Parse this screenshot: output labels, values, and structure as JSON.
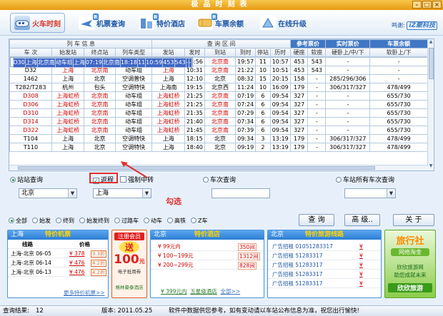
{
  "window": {
    "title": "极品时刻表",
    "min": "–",
    "max": "□",
    "close": "×"
  },
  "toolbar": {
    "items": [
      {
        "label": "火车时刻",
        "icon": "train-icon"
      },
      {
        "label": "机票查询",
        "icon": "plane-icon",
        "new": "新"
      },
      {
        "label": "特价酒店",
        "icon": "hotel-icon",
        "new": "新"
      },
      {
        "label": "车票余额",
        "icon": "ticket-icon",
        "new": "新"
      },
      {
        "label": "在线升级",
        "icon": "upgrade-icon"
      }
    ],
    "brand_prefix": "鸣谢:",
    "brand": "iZ聚科技"
  },
  "table": {
    "group_headers": [
      "列 车 信 息",
      "查 询 区 间",
      "参考票价",
      "实时票价",
      "车票余额"
    ],
    "columns": [
      "车 次",
      "始发站",
      "终点站",
      "列车类型",
      "发站",
      "发时",
      "到站",
      "到时",
      "停站",
      "历时",
      "硬座",
      "软座",
      "硬卧上/中/下",
      "软卧上/下"
    ],
    "rows": [
      [
        "D30",
        "上海",
        "北京南",
        "动车组",
        "上海",
        "07:19",
        "北京南",
        "18:18",
        "11",
        "10:59",
        "453",
        "543",
        "-",
        "-"
      ],
      [
        "D72",
        "上海",
        "北京南",
        "动车组",
        "上海",
        "08:56",
        "北京南",
        "19:57",
        "11",
        "10:57",
        "453",
        "543",
        "-",
        "-"
      ],
      [
        "D32",
        "上海",
        "北京南",
        "动车组",
        "上海",
        "10:31",
        "北京南",
        "21:22",
        "10",
        "10:51",
        "453",
        "543",
        "-",
        "-"
      ],
      [
        "1462",
        "上海",
        "北京",
        "空调普快",
        "上海",
        "12:10",
        "北京",
        "08:32",
        "15",
        "20:15",
        "158",
        "-",
        "285/296/306",
        "-"
      ],
      [
        "T282/T283",
        "杭州",
        "包头",
        "空调特快",
        "上海南",
        "19:15",
        "北京西",
        "11:24",
        "10",
        "16:09",
        "179",
        "-",
        "306/317/327",
        "478/499"
      ],
      [
        "D308",
        "上海虹桥",
        "北京南",
        "动车组",
        "上海虹桥",
        "21:25",
        "北京南",
        "07:19",
        "6",
        "09:54",
        "327",
        "-",
        "-",
        "655/730"
      ],
      [
        "D306",
        "上海虹桥",
        "北京南",
        "动车组",
        "上海虹桥",
        "21:25",
        "北京南",
        "07:24",
        "6",
        "09:54",
        "327",
        "-",
        "-",
        "655/730"
      ],
      [
        "D310",
        "上海虹桥",
        "北京南",
        "动车组",
        "上海虹桥",
        "21:35",
        "北京南",
        "07:29",
        "6",
        "09:54",
        "327",
        "-",
        "-",
        "655/730"
      ],
      [
        "D314",
        "上海虹桥",
        "北京南",
        "动车组",
        "上海虹桥",
        "21:40",
        "北京南",
        "07:34",
        "6",
        "09:54",
        "327",
        "-",
        "-",
        "655/730"
      ],
      [
        "D322",
        "上海虹桥",
        "北京南",
        "动车组",
        "上海虹桥",
        "21:45",
        "北京南",
        "07:39",
        "6",
        "09:54",
        "327",
        "-",
        "-",
        "655/730"
      ],
      [
        "T104",
        "上海",
        "北京",
        "空调特快",
        "上海",
        "18:15",
        "北京",
        "09:34",
        "3",
        "13:19",
        "179",
        "-",
        "306/317/327",
        "478/499"
      ],
      [
        "T110",
        "上海",
        "北京",
        "空调特快",
        "上海",
        "18:40",
        "北京",
        "09:19",
        "2",
        "13:19",
        "179",
        "-",
        "306/317/327",
        "478/499"
      ]
    ]
  },
  "search": {
    "station_query": "站站查询",
    "return_label": "返程",
    "force_transfer_label": "强制中转",
    "from": "北京",
    "to": "上海",
    "train_query": "车次查询",
    "train_value": "",
    "station_all_trains": "车站所有车次查询",
    "station_value": "",
    "annotation": "勾选"
  },
  "filters": {
    "options": [
      "全部",
      "始发",
      "终到",
      "始发终到",
      "过路车",
      "动车",
      "高铁",
      "Z车"
    ],
    "query_btn": "查 询",
    "advanced_btn": "高 级..",
    "about_btn": "关 于"
  },
  "ads": {
    "flights": {
      "city": "上海",
      "title": "特价机票",
      "col1": "线路",
      "col2": "价格",
      "rows": [
        {
          "route": "上海-北京 06-05",
          "price": "¥ 378",
          "tag": "3.3折"
        },
        {
          "route": "上海-北京 06-14",
          "price": "¥ 476",
          "tag": "4.2折"
        },
        {
          "route": "上海-北京 06-13",
          "price": "¥ 476",
          "tag": "4.2折"
        }
      ],
      "more": "更多特价机票>>"
    },
    "member": {
      "line1": "注册会员",
      "line2": "送",
      "line3": "100",
      "line4": "元",
      "line5": "电子抵用券",
      "line6": "格林豪泰酒店"
    },
    "hotels": {
      "city": "北京",
      "title": "特价酒店",
      "rows": [
        {
          "range": "¥ 99元内",
          "count": "350间"
        },
        {
          "range": "¥ 100~199元",
          "count": "1312间"
        },
        {
          "range": "¥ 200~299元",
          "count": "828间"
        }
      ],
      "link1": "¥ 399元内",
      "link2": "五星级酒店",
      "link3": "全部>>"
    },
    "tours": {
      "city": "北京",
      "title": "特价旅游线路",
      "rows": [
        {
          "text": "广告招租 01051283317",
          "price": "¥"
        },
        {
          "text": "广告招租 51283317",
          "price": "¥"
        },
        {
          "text": "广告招租 51283317",
          "price": "¥"
        },
        {
          "text": "广告招租 51283317",
          "price": "¥"
        },
        {
          "text": "广告招租 51283317",
          "price": "¥"
        }
      ]
    },
    "agency": {
      "title": "旅行社",
      "sub": "网络淘金",
      "l1": "欣欣旅游网",
      "l2": "助您成就未来",
      "l3": "欣欣旅游"
    }
  },
  "status": {
    "result_label": "查询结果:",
    "result_count": "12",
    "version": "版本: 2011.05.25",
    "notice": "软件中数据供您参考，如有变动请以车站公布信息为准，祝您出行愉快!"
  },
  "colors": {
    "selected_row": "#3e66c6",
    "red_text": "#d00000",
    "panel_blue": "#2d7ed2",
    "titlebar": "#e79a12"
  }
}
